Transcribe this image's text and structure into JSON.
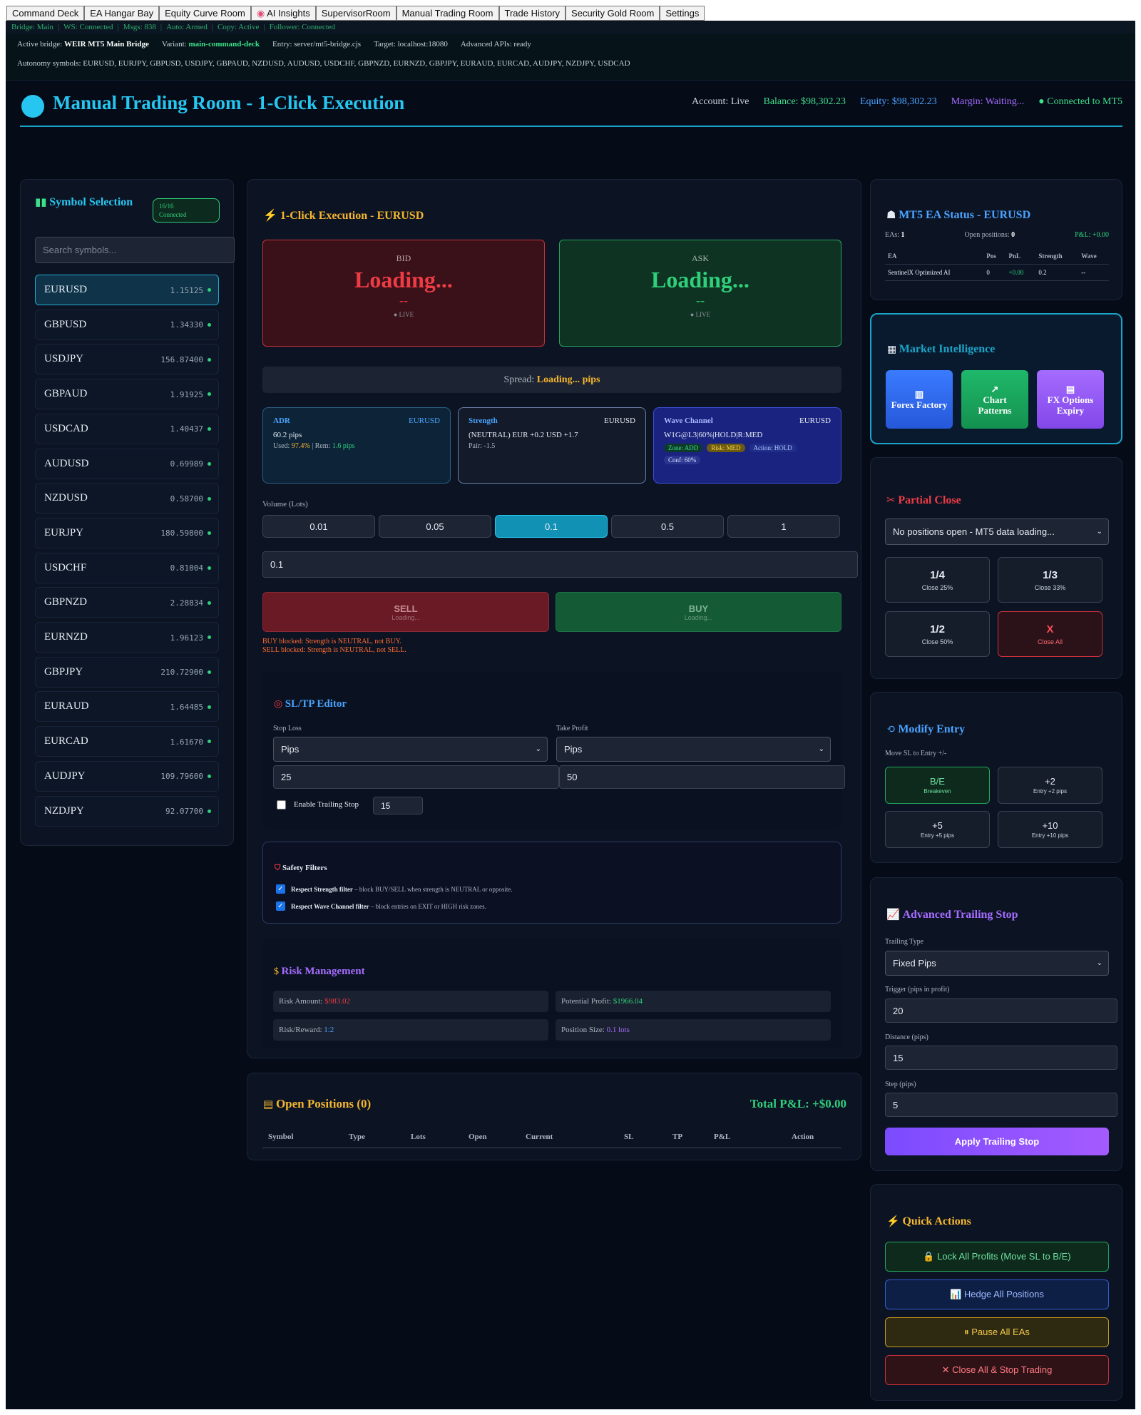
{
  "nav": {
    "tabs": [
      "Command Deck",
      "EA Hangar Bay",
      "Equity Curve Room",
      "AI Insights",
      "SupervisorRoom",
      "Manual Trading Room",
      "Trade History",
      "Security Gold Room",
      "Settings"
    ],
    "ai_icon": "brain-icon"
  },
  "status": {
    "bridge": "Bridge: Main",
    "ws": "WS: Connected",
    "msgs": "Msgs: 838",
    "auto": "Auto: Armed",
    "copy": "Copy: Active",
    "follower": "Follower: Connected"
  },
  "bridge": {
    "active_label": "Active bridge:",
    "active_value": "WEIR MT5 Main Bridge",
    "variant_label": "Variant:",
    "variant_value": "main-command-deck",
    "entry": "Entry: server/mt5-bridge.cjs",
    "target": "Target: localhost:18080",
    "apis": "Advanced APIs: ready",
    "autonomy": "Autonomy symbols: EURUSD, EURJPY, GBPUSD, USDJPY, GBPAUD, NZDUSD, AUDUSD, USDCHF, GBPNZD, EURNZD, GBPJPY, EURAUD, EURCAD, AUDJPY, NZDJPY, USDCAD"
  },
  "header": {
    "title": "Manual Trading Room - 1-Click Execution",
    "account": "Account: Live",
    "balance": "Balance: $98,302.23",
    "equity": "Equity: $98,302.23",
    "margin": "Margin: Waiting...",
    "connection": "● Connected to MT5"
  },
  "symbols": {
    "title": "Symbol Selection",
    "badge_count": "16/16",
    "badge_status": "Connected",
    "search_placeholder": "Search symbols...",
    "items": [
      {
        "name": "EURUSD",
        "price": "1.15125"
      },
      {
        "name": "GBPUSD",
        "price": "1.34330"
      },
      {
        "name": "USDJPY",
        "price": "156.87400"
      },
      {
        "name": "GBPAUD",
        "price": "1.91925"
      },
      {
        "name": "USDCAD",
        "price": "1.40437"
      },
      {
        "name": "AUDUSD",
        "price": "0.69989"
      },
      {
        "name": "NZDUSD",
        "price": "0.58700"
      },
      {
        "name": "EURJPY",
        "price": "180.59800"
      },
      {
        "name": "USDCHF",
        "price": "0.81004"
      },
      {
        "name": "GBPNZD",
        "price": "2.28834"
      },
      {
        "name": "EURNZD",
        "price": "1.96123"
      },
      {
        "name": "GBPJPY",
        "price": "210.72900"
      },
      {
        "name": "EURAUD",
        "price": "1.64485"
      },
      {
        "name": "EURCAD",
        "price": "1.61670"
      },
      {
        "name": "AUDJPY",
        "price": "109.79600"
      },
      {
        "name": "NZDJPY",
        "price": "92.07700"
      }
    ]
  },
  "execution": {
    "title": "1-Click Execution - EURUSD",
    "bid_label": "BID",
    "bid_value": "Loading...",
    "bid_change": "--",
    "ask_label": "ASK",
    "ask_value": "Loading...",
    "ask_change": "--",
    "live": "● LIVE",
    "spread_label": "Spread:",
    "spread_value": "Loading... pips",
    "adr": {
      "title": "ADR",
      "symbol": "EURUSD",
      "value": "60.2 pips",
      "used_label": "Used:",
      "used_value": "97.4%",
      "rem_label": "| Rem:",
      "rem_value": "1.6 pips"
    },
    "strength": {
      "title": "Strength",
      "symbol": "EURUSD",
      "value": "(NEUTRAL) EUR +0.2 USD +1.7",
      "pair": "Pair: -1.5"
    },
    "wave": {
      "title": "Wave Channel",
      "symbol": "EURUSD",
      "value": "W1G@L3|60%|HOLD|R:MED",
      "zone": "Zone: ADD",
      "risk": "Risk: MED",
      "action": "Action: HOLD",
      "conf": "Conf: 60%"
    },
    "volume_label": "Volume (Lots)",
    "volume_options": [
      "0.01",
      "0.05",
      "0.1",
      "0.5",
      "1"
    ],
    "volume_value": "0.1",
    "sell_label": "SELL",
    "sell_sub": "Loading...",
    "buy_label": "BUY",
    "buy_sub": "Loading...",
    "blocked_buy": "BUY blocked: Strength is NEUTRAL, not BUY.",
    "blocked_sell": "SELL blocked: Strength is NEUTRAL, not SELL.",
    "accent": "#f5b62e"
  },
  "sltp": {
    "title": "SL/TP Editor",
    "sl_label": "Stop Loss",
    "tp_label": "Take Profit",
    "sl_mode": "Pips",
    "tp_mode": "Pips",
    "sl_value": "25",
    "tp_value": "50",
    "trailing_label": "Enable Trailing Stop",
    "trailing_value": "15"
  },
  "safety": {
    "title": "Safety Filters",
    "f1_bold": "Respect Strength filter",
    "f1_text": " – block BUY/SELL when strength is NEUTRAL or opposite.",
    "f2_bold": "Respect Wave Channel filter",
    "f2_text": " – block entries on EXIT or HIGH risk zones."
  },
  "risk": {
    "title": "Risk Management",
    "amount_label": "Risk Amount:",
    "amount_value": "$983.02",
    "profit_label": "Potential Profit:",
    "profit_value": "$1966.04",
    "rr_label": "Risk/Reward:",
    "rr_value": "1:2",
    "size_label": "Position Size:",
    "size_value": "0.1 lots"
  },
  "positions": {
    "title": "Open Positions (0)",
    "total": "Total P&L: +$0.00",
    "columns": [
      "Symbol",
      "Type",
      "Lots",
      "Open",
      "Current",
      "SL",
      "TP",
      "P&L",
      "Action"
    ]
  },
  "ea_status": {
    "title": "MT5 EA Status - EURUSD",
    "eas_label": "EAs:",
    "eas_value": "1",
    "open_label": "Open positions:",
    "open_value": "0",
    "pnl": "P&L: +0.00",
    "columns": [
      "EA",
      "Pos",
      "PnL",
      "Strength",
      "Wave"
    ],
    "rows": [
      [
        "SentinelX Optimized AI",
        "0",
        "+0.00",
        "0.2",
        "--"
      ]
    ]
  },
  "market": {
    "title": "Market Intelligence",
    "buttons": [
      {
        "label": "Forex Factory",
        "icon": "bar-chart-icon"
      },
      {
        "label": "Chart Patterns",
        "icon": "line-chart-icon"
      },
      {
        "label": "FX Options Expiry",
        "icon": "calendar-icon"
      }
    ]
  },
  "partial": {
    "title": "Partial Close",
    "select_value": "No positions open - MT5 data loading...",
    "buttons": [
      {
        "label": "1/4",
        "sub": "Close 25%"
      },
      {
        "label": "1/3",
        "sub": "Close 33%"
      },
      {
        "label": "1/2",
        "sub": "Close 50%"
      },
      {
        "label": "X",
        "sub": "Close All"
      }
    ]
  },
  "modify": {
    "title": "Modify Entry",
    "subtitle": "Move SL to Entry +/-",
    "buttons": [
      {
        "label": "B/E",
        "sub": "Breakeven"
      },
      {
        "label": "+2",
        "sub": "Entry +2 pips"
      },
      {
        "label": "+5",
        "sub": "Entry +5 pips"
      },
      {
        "label": "+10",
        "sub": "Entry +10 pips"
      }
    ]
  },
  "trailing": {
    "title": "Advanced Trailing Stop",
    "type_label": "Trailing Type",
    "type_value": "Fixed Pips",
    "trigger_label": "Trigger (pips in profit)",
    "trigger_value": "20",
    "distance_label": "Distance (pips)",
    "distance_value": "15",
    "step_label": "Step (pips)",
    "step_value": "5",
    "apply": "Apply Trailing Stop"
  },
  "quick": {
    "title": "Quick Actions",
    "lock": "🔒 Lock All Profits (Move SL to B/E)",
    "hedge": "📊 Hedge All Positions",
    "pause": "⏸ Pause All EAs",
    "close": "✕ Close All & Stop Trading"
  }
}
